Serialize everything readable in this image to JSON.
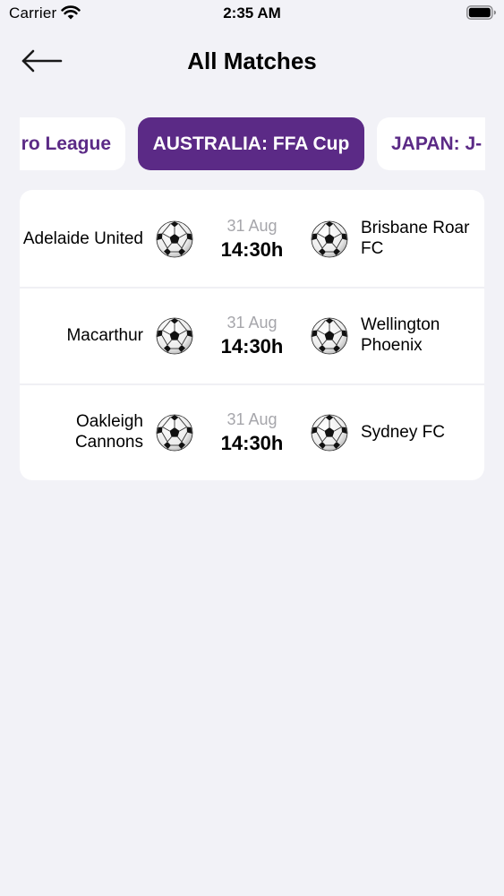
{
  "status_bar": {
    "carrier": "Carrier",
    "time": "2:35 AM"
  },
  "header": {
    "title": "All Matches",
    "back_icon": "arrow-left-icon"
  },
  "tabs": [
    {
      "label": "ro League",
      "active": false
    },
    {
      "label": "AUSTRALIA: FFA Cup",
      "active": true
    },
    {
      "label": "JAPAN: J-",
      "active": false
    }
  ],
  "matches": [
    {
      "home": "Adelaide United",
      "away": "Brisbane Roar FC",
      "date": "31 Aug",
      "time": "14:30h"
    },
    {
      "home": "Macarthur",
      "away": "Wellington Phoenix",
      "date": "31 Aug",
      "time": "14:30h"
    },
    {
      "home": "Oakleigh Cannons",
      "away": "Sydney FC",
      "date": "31 Aug",
      "time": "14:30h"
    }
  ],
  "colors": {
    "accent": "#5b2a86",
    "background": "#f2f2f7",
    "card": "#ffffff",
    "muted_text": "#a6a6ab"
  }
}
